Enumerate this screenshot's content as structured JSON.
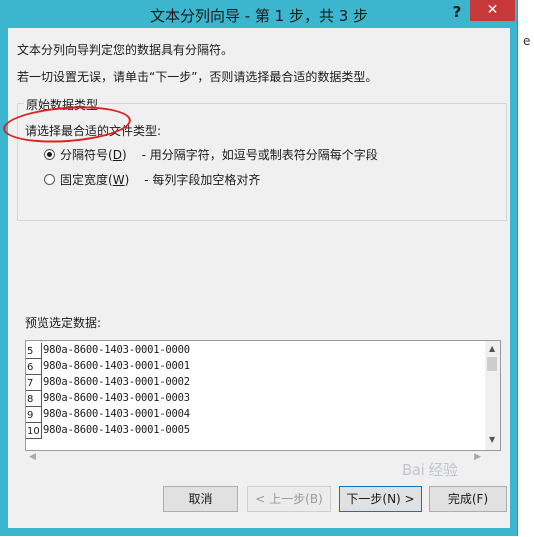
{
  "window": {
    "title": "文本分列向导 - 第 1 步，共 3 步",
    "help_label": "?",
    "close_label": "✕"
  },
  "background_fragment": "e",
  "intro": {
    "line1": "文本分列向导判定您的数据具有分隔符。",
    "line2": "若一切设置无误，请单击“下一步”，否则请选择最合适的数据类型。"
  },
  "group": {
    "title": "原始数据类型",
    "prompt": "请选择最合适的文件类型:",
    "options": [
      {
        "label": "分隔符号(",
        "key": "D",
        "suffix": ")",
        "desc": "- 用分隔字符，如逗号或制表符分隔每个字段",
        "selected": true
      },
      {
        "label": "固定宽度(",
        "key": "W",
        "suffix": ")",
        "desc": "- 每列字段加空格对齐",
        "selected": false
      }
    ]
  },
  "preview": {
    "label": "预览选定数据:",
    "rows": [
      {
        "num": "5",
        "value": "980a-8600-1403-0001-0000"
      },
      {
        "num": "6",
        "value": "980a-8600-1403-0001-0001"
      },
      {
        "num": "7",
        "value": "980a-8600-1403-0001-0002"
      },
      {
        "num": "8",
        "value": "980a-8600-1403-0001-0003"
      },
      {
        "num": "9",
        "value": "980a-8600-1403-0001-0004"
      },
      {
        "num": "10",
        "value": "980a-8600-1403-0001-0005"
      }
    ]
  },
  "buttons": {
    "cancel": "取消",
    "back": "< 上一步(B)",
    "next": "下一步(N) >",
    "finish": "完成(F)"
  },
  "watermark": "Bai 经验",
  "colors": {
    "titlebar": "#3cb6ce",
    "close": "#c7383a",
    "annotation": "#e02020"
  }
}
